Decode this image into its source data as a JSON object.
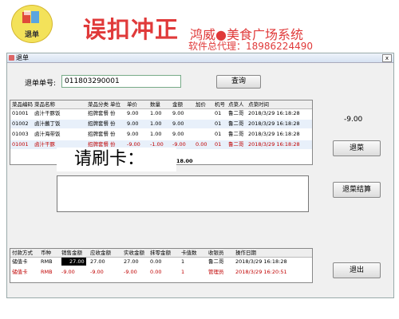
{
  "banner": {
    "logo_label": "退单",
    "title": "误扣冲正",
    "brand": "鸿威●美食广场系统",
    "agent": "软件总代理：18986224490"
  },
  "window": {
    "title": "退单",
    "close": "x"
  },
  "form": {
    "order_label": "退单单号:",
    "order_value": "011803290001",
    "query_btn": "查询",
    "amount": "-9.00"
  },
  "buttons": {
    "return_dish": "退菜",
    "return_checkout": "退菜结算",
    "exit": "退出"
  },
  "popup": {
    "prompt": "请刷卡："
  },
  "dish_table": {
    "headers": [
      "菜品编码",
      "菜品名称",
      "菜品分类",
      "单位",
      "单价",
      "数量",
      "金额",
      "加价",
      "机号",
      "点菜人",
      "点菜时间"
    ],
    "rows": [
      [
        "01001",
        "卤汁干豚饭",
        "招牌套餐",
        "份",
        "9.00",
        "1.00",
        "9.00",
        "",
        "01",
        "鲁二哥",
        "2018/3/29 16:18:28"
      ],
      [
        "01002",
        "卤汁蘸丁饭",
        "招牌套餐",
        "份",
        "9.00",
        "1.00",
        "9.00",
        "",
        "01",
        "鲁二哥",
        "2018/3/29 16:18:28"
      ],
      [
        "01003",
        "卤汁海带饭",
        "招牌套餐",
        "份",
        "9.00",
        "1.00",
        "9.00",
        "",
        "01",
        "鲁二哥",
        "2018/3/29 16:18:28"
      ],
      [
        "01001",
        "卤汁干豚",
        "招牌套餐",
        "份",
        "-9.00",
        "-1.00",
        "-9.00",
        "0.00",
        "01",
        "鲁二哥",
        "2018/3/29 16:18:28"
      ]
    ],
    "total": "18.00"
  },
  "pay_table": {
    "headers": [
      "付款方式",
      "币种",
      "销售金额",
      "应收金额",
      "实收金额",
      "抹零金额",
      "卡值数",
      "收银员",
      "操作日期"
    ],
    "rows": [
      [
        "储值卡",
        "RMB",
        "27.00",
        "27.00",
        "27.00",
        "0.00",
        "1",
        "鲁二哥",
        "2018/3/29 16:18:28"
      ],
      [
        "储值卡",
        "RMB",
        "-9.00",
        "-9.00",
        "-9.00",
        "0.00",
        "1",
        "管理员",
        "2018/3/29 16:20:51"
      ]
    ]
  },
  "colors": {
    "accent": "#e03a3a",
    "neg": "#c00000",
    "rowalt": "#e8f0fa"
  }
}
